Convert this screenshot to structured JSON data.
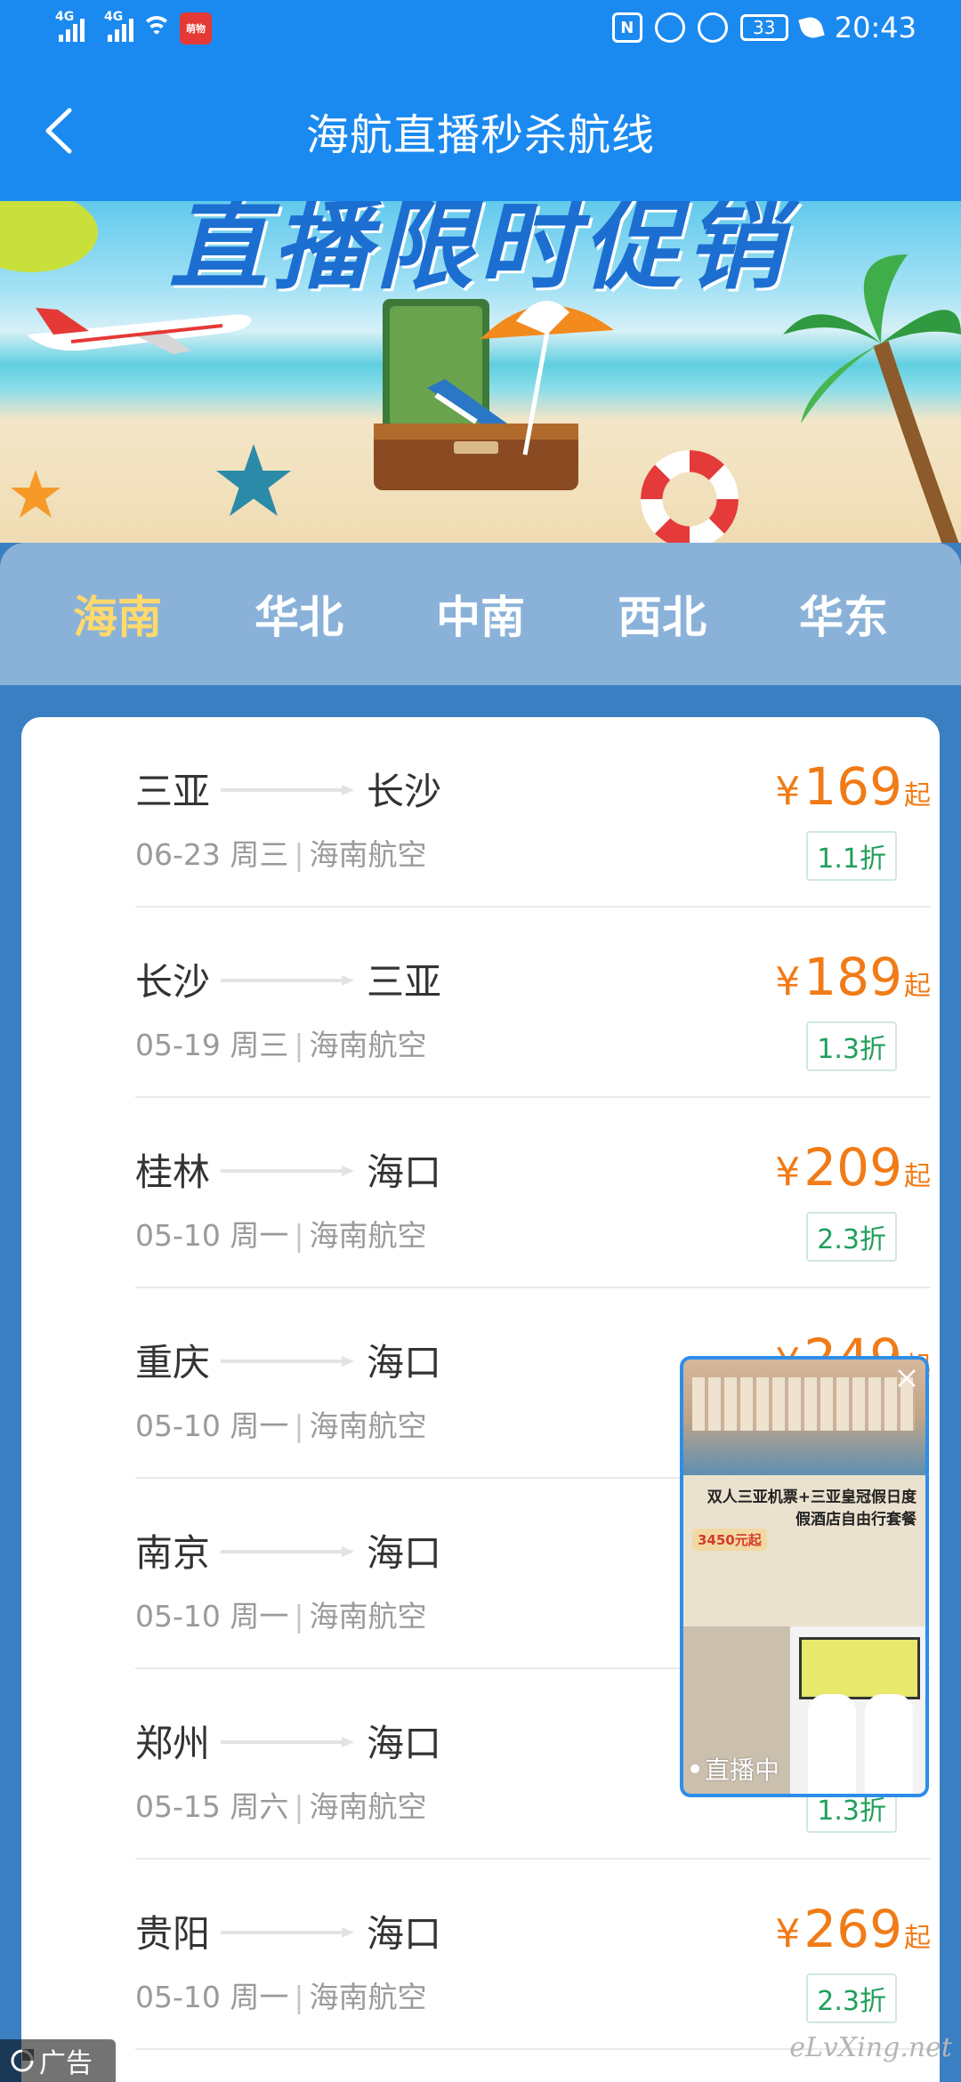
{
  "status_bar": {
    "network_1": "4G",
    "network_2": "4G",
    "app_badge": "萌物",
    "battery": "33",
    "time": "20:43"
  },
  "header": {
    "title": "海航直播秒杀航线"
  },
  "banner": {
    "title_text": "直播限时促销"
  },
  "tabs": [
    {
      "label": "海南",
      "active": true
    },
    {
      "label": "华北",
      "active": false
    },
    {
      "label": "中南",
      "active": false
    },
    {
      "label": "西北",
      "active": false
    },
    {
      "label": "华东",
      "active": false
    }
  ],
  "flights": [
    {
      "from": "三亚",
      "to": "长沙",
      "date": "06-23 周三",
      "airline": "海南航空",
      "price": "169",
      "currency": "¥",
      "suffix": "起",
      "discount": "1.1折"
    },
    {
      "from": "长沙",
      "to": "三亚",
      "date": "05-19 周三",
      "airline": "海南航空",
      "price": "189",
      "currency": "¥",
      "suffix": "起",
      "discount": "1.3折"
    },
    {
      "from": "桂林",
      "to": "海口",
      "date": "05-10 周一",
      "airline": "海南航空",
      "price": "209",
      "currency": "¥",
      "suffix": "起",
      "discount": "2.3折"
    },
    {
      "from": "重庆",
      "to": "海口",
      "date": "05-10 周一",
      "airline": "海南航空",
      "price": "249",
      "currency": "¥",
      "suffix": "起",
      "discount": ""
    },
    {
      "from": "南京",
      "to": "海口",
      "date": "05-10 周一",
      "airline": "海南航空",
      "price": "",
      "currency": "",
      "suffix": "",
      "discount": ""
    },
    {
      "from": "郑州",
      "to": "海口",
      "date": "05-15 周六",
      "airline": "海南航空",
      "price": "",
      "currency": "",
      "suffix": "",
      "discount": "1.3折"
    },
    {
      "from": "贵阳",
      "to": "海口",
      "date": "05-10 周一",
      "airline": "海南航空",
      "price": "269",
      "currency": "¥",
      "suffix": "起",
      "discount": "2.3折"
    }
  ],
  "live_ad": {
    "promo_title": "双人三亚机票+三亚皇冠假日度假酒店自由行套餐",
    "promo_price": "3450元起",
    "badge": "直播中"
  },
  "ad_label": "广告",
  "watermark": "eLvXing.net",
  "colors": {
    "header_bg": "#1b8af0",
    "tab_bar_bg": "#8ab2d9",
    "active_tab": "#ffd96b",
    "price": "#f07b17",
    "discount": "#1f9f5a",
    "page_bg": "#3a7fc1"
  }
}
